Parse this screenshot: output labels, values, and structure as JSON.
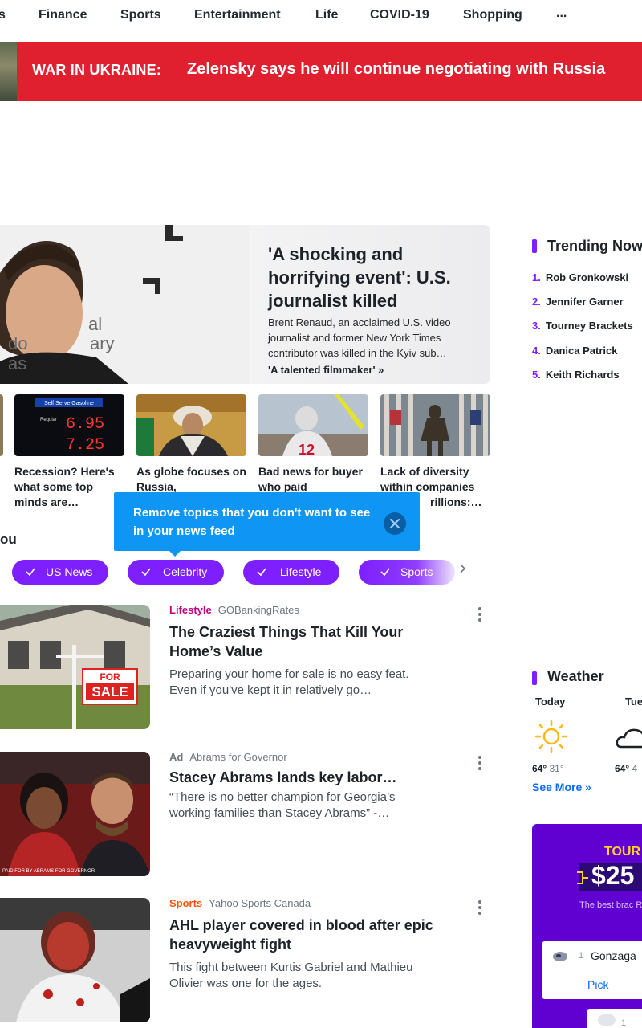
{
  "nav": {
    "items": [
      "s",
      "Finance",
      "Sports",
      "Entertainment",
      "Life",
      "COVID-19",
      "Shopping",
      "..."
    ]
  },
  "banner": {
    "label": "WAR IN UKRAINE:",
    "headline": "Zelensky says he will continue negotiating with Russia"
  },
  "hero": {
    "title": "'A shocking and horrifying event': U.S. journalist killed",
    "description": "Brent Renaud, an acclaimed U.S. video journalist and former New York Times contributor was killed in the Kyiv sub…",
    "link": "'A talented filmmaker' »",
    "image_text": "nal\ndo ary\nas"
  },
  "thumbs": [
    {
      "caption": "Recession? Here's what some top minds are…",
      "sign_title": "Self Serve Gasoline",
      "sign_regular": "Regular",
      "price1": "6.95",
      "price2": "7.25"
    },
    {
      "caption": "As globe focuses on Russia,"
    },
    {
      "caption": "Bad news for buyer who paid"
    },
    {
      "caption": "Lack of diversity within companies",
      "caption_tail": "rillions:…"
    }
  ],
  "tooltip": {
    "text": "Remove topics that you don't want to see in your news feed"
  },
  "for_you": {
    "label": "ou"
  },
  "pills": [
    "US News",
    "Celebrity",
    "Lifestyle",
    "Sports"
  ],
  "stream": [
    {
      "category": "Lifestyle",
      "category_color": "#c5007f",
      "source": "GOBankingRates",
      "title": "The Craziest Things That Kill Your Home’s Value",
      "description": "Preparing your home for sale is no easy feat. Even if you've kept it in relatively go…",
      "sign_top": "FOR",
      "sign_bottom": "SALE"
    },
    {
      "category": "Ad",
      "category_color": "#6e7780",
      "source": "Abrams for Governor",
      "title": "Stacey Abrams lands key labor…",
      "description": "“There is no better champion for Georgia’s working families than Stacey Abrams” -…",
      "image_caption": "PAID FOR BY ABRAMS FOR GOVERNOR"
    },
    {
      "category": "Sports",
      "category_color": "#ff520d",
      "source": "Yahoo Sports Canada",
      "title": "AHL player covered in blood after epic heavyweight fight",
      "description": "This fight between Kurtis Gabriel and Mathieu Olivier was one for the ages."
    }
  ],
  "trending": {
    "heading": "Trending Now",
    "items": [
      "Rob Gronkowski",
      "Jennifer Garner",
      "Tourney Brackets",
      "Danica Patrick",
      "Keith Richards"
    ]
  },
  "weather": {
    "heading": "Weather",
    "days": [
      {
        "day": "Today",
        "high": "64°",
        "low": "31°",
        "icon": "sun-icon"
      },
      {
        "day": "Tue",
        "high": "64°",
        "low": "4",
        "icon": "cloud-icon"
      }
    ],
    "more": "See More »"
  },
  "promo": {
    "title": "TOUR",
    "amount": "$25",
    "subtitle": "The best brac R",
    "team_seed": "1",
    "team": "Gonzaga",
    "pick": "Pick",
    "next_seed": "1"
  }
}
